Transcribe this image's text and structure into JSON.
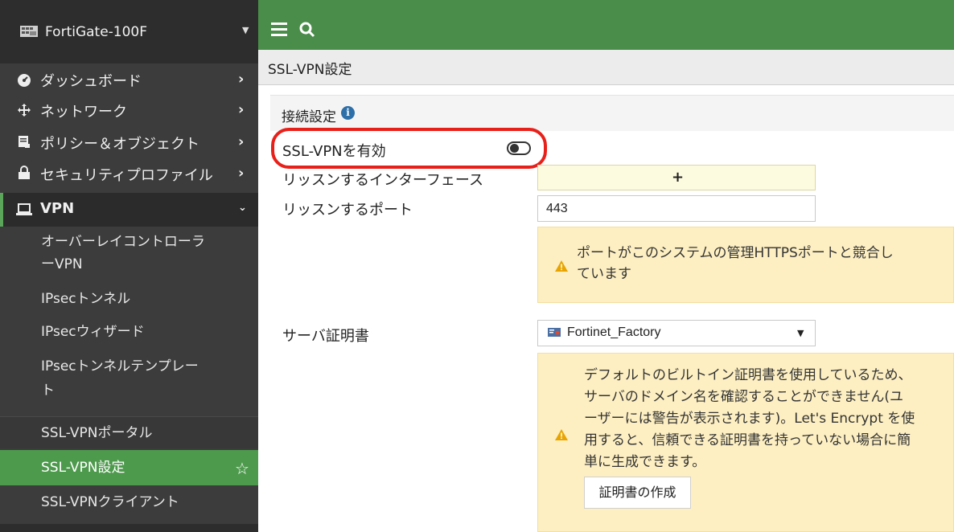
{
  "sidebar": {
    "device_name": "FortiGate-100F",
    "items": [
      {
        "label": "ダッシュボード",
        "icon": "dashboard-icon"
      },
      {
        "label": "ネットワーク",
        "icon": "network-icon"
      },
      {
        "label": "ポリシー＆オブジェクト",
        "icon": "policy-icon"
      },
      {
        "label": "セキュリティプロファイル",
        "icon": "lock-icon"
      }
    ],
    "vpn": {
      "label": "VPN",
      "sub_items": [
        {
          "label_line1": "オーバーレイコントローラ",
          "label_line2": "ーVPN"
        },
        {
          "label": "IPsecトンネル"
        },
        {
          "label": "IPsecウィザード"
        },
        {
          "label_line1": "IPsecトンネルテンプレー",
          "label_line2": "ト"
        },
        {
          "label": "SSL-VPNポータル"
        },
        {
          "label": "SSL-VPN設定"
        },
        {
          "label": "SSL-VPNクライアント"
        }
      ]
    }
  },
  "header": {
    "page_title": "SSL-VPN設定"
  },
  "content": {
    "section_title": "接続設定",
    "enable_label": "SSL-VPNを有効",
    "enable_state": "off",
    "listen_iface_label": "リッスンするインターフェース",
    "listen_iface_add": "+",
    "listen_port_label": "リッスンするポート",
    "listen_port_value": "443",
    "port_warning_line1": "ポートがこのシステムの管理HTTPSポートと競合し",
    "port_warning_line2": "ています",
    "server_cert_label": "サーバ証明書",
    "server_cert_value": "Fortinet_Factory",
    "cert_warning_lines": [
      "デフォルトのビルトイン証明書を使用しているため、",
      "サーバのドメイン名を確認することができません(ユ",
      "ーザーには警告が表示されます)。Let's Encrypt を使",
      "用すると、信頼できる証明書を持っていない場合に簡",
      "単に生成できます。"
    ],
    "create_cert_button": "証明書の作成"
  },
  "colors": {
    "topbar": "#4a8d4a",
    "active_item": "#4e9a4d",
    "highlight_ring": "#e8201a",
    "warning_bg": "#fdefc2"
  }
}
